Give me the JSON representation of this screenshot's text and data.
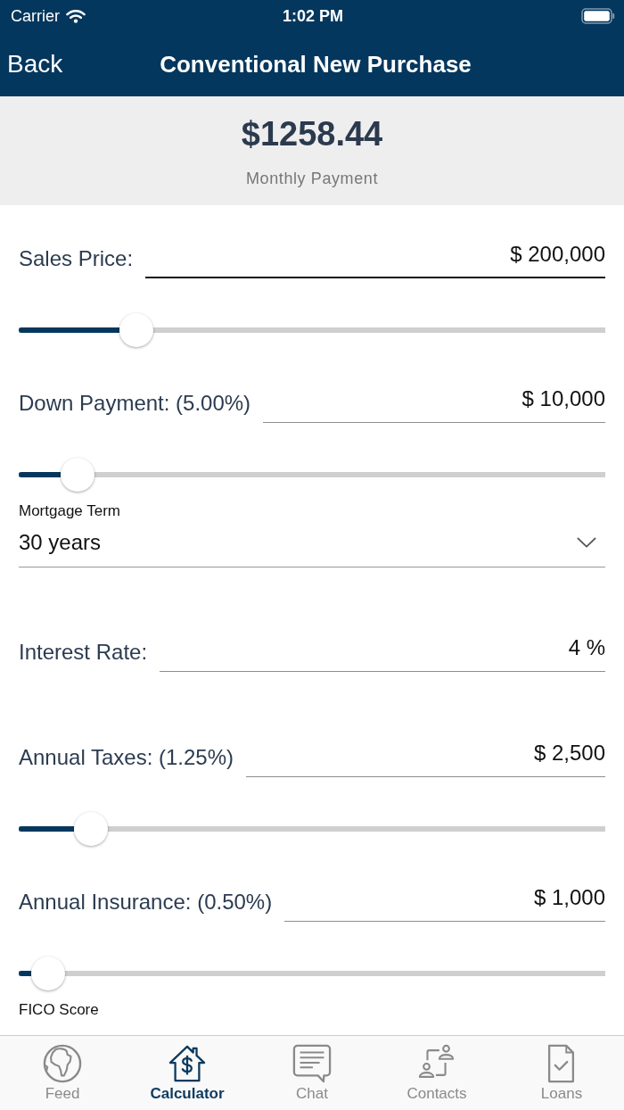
{
  "status_bar": {
    "carrier": "Carrier",
    "time": "1:02 PM"
  },
  "nav_bar": {
    "back": "Back",
    "title": "Conventional New Purchase"
  },
  "summary": {
    "amount": "$1258.44",
    "label": "Monthly Payment"
  },
  "form": [
    {
      "kind": "input",
      "label": "Sales Price:",
      "value": "$ 200,000",
      "focused": true
    },
    {
      "kind": "slider",
      "level": 0.2
    },
    {
      "kind": "input",
      "label": "Down Payment: (5.00%)",
      "value": "$ 10,000",
      "focused": false
    },
    {
      "kind": "slider",
      "level": 0.1
    },
    {
      "kind": "select",
      "label": "Mortgage Term",
      "value": "30 years"
    },
    {
      "kind": "input",
      "label": "Interest Rate:",
      "value": "4 %",
      "focused": false
    },
    {
      "kind": "input",
      "label": "Annual Taxes: (1.25%)",
      "value": "$ 2,500",
      "focused": false
    },
    {
      "kind": "slider",
      "level": 0.123
    },
    {
      "kind": "input",
      "label": "Annual Insurance: (0.50%)",
      "value": "$ 1,000",
      "focused": false
    },
    {
      "kind": "slider",
      "level": 0.05
    },
    {
      "kind": "select",
      "label": "FICO Score"
    }
  ],
  "tab_bar": [
    {
      "label": "Feed",
      "selected": false
    },
    {
      "label": "Calculator",
      "selected": true
    },
    {
      "label": "Chat",
      "selected": false
    },
    {
      "label": "Contacts",
      "selected": false
    },
    {
      "label": "Loans",
      "selected": false
    }
  ]
}
